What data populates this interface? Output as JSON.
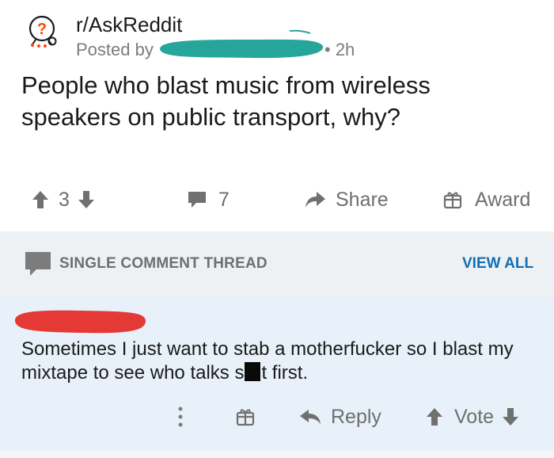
{
  "post": {
    "subreddit": "r/AskReddit",
    "posted_by_label": "Posted by",
    "age": "• 2h",
    "title": "People who blast music from wireless speakers on public transport, why?",
    "votes": "3",
    "comments": "7",
    "share_label": "Share",
    "award_label": "Award",
    "username_redaction_color": "#26a69a"
  },
  "thread": {
    "label": "SINGLE COMMENT THREAD",
    "view_all": "VIEW ALL",
    "link_color": "#0f6fb7"
  },
  "comment": {
    "commenter_redaction_color": "#e53935",
    "text_before": "Sometimes I just want to stab a motherfucker so I blast my mixtape to see who talks s",
    "text_after": "t first.",
    "reply_label": "Reply",
    "vote_label": "Vote"
  }
}
